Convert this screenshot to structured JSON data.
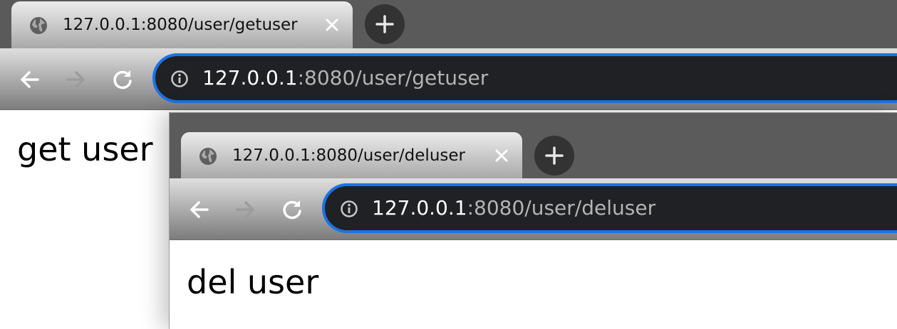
{
  "windows": [
    {
      "tab": {
        "title": "127.0.0.1:8080/user/getuser",
        "favicon": "globe-icon",
        "close_icon": "close-icon"
      },
      "new_tab_icon": "plus-icon",
      "toolbar": {
        "back_icon": "arrow-back-icon",
        "forward_icon": "arrow-forward-icon",
        "reload_icon": "reload-icon",
        "info_icon": "info-icon"
      },
      "address": {
        "host": "127.0.0.1",
        "rest": ":8080/user/getuser"
      },
      "content": {
        "text": "get user"
      }
    },
    {
      "tab": {
        "title": "127.0.0.1:8080/user/deluser",
        "favicon": "globe-icon",
        "close_icon": "close-icon"
      },
      "new_tab_icon": "plus-icon",
      "toolbar": {
        "back_icon": "arrow-back-icon",
        "forward_icon": "arrow-forward-icon",
        "reload_icon": "reload-icon",
        "info_icon": "info-icon"
      },
      "address": {
        "host": "127.0.0.1",
        "rest": ":8080/user/deluser"
      },
      "content": {
        "text": "del user"
      }
    }
  ],
  "colors": {
    "tabstrip": "#5a5a5a",
    "omnibox_bg": "#202124",
    "omnibox_focus_ring": "#1a73e8",
    "url_host": "#ffffff",
    "url_rest": "#b4b4b4"
  }
}
